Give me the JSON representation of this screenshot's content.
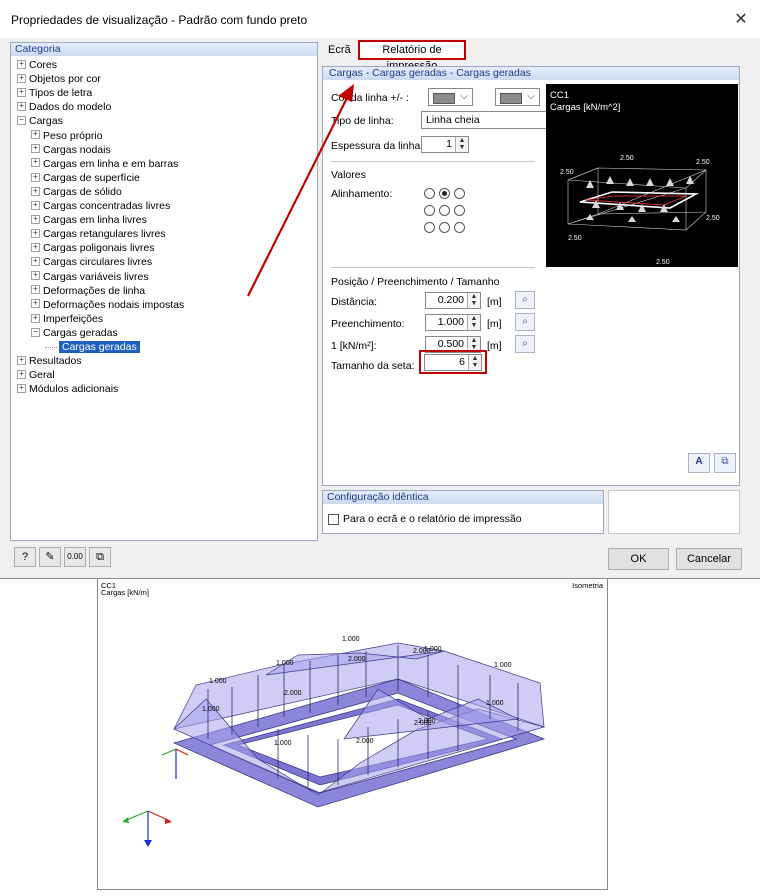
{
  "dialog": {
    "title": "Propriedades de visualização - Padrão com fundo preto",
    "close_glyph": "✕"
  },
  "category": {
    "header": "Categoria",
    "tree": [
      {
        "label": "Cores",
        "indent": 0,
        "expander": "+"
      },
      {
        "label": "Objetos por cor",
        "indent": 0,
        "expander": "+"
      },
      {
        "label": "Tipos de letra",
        "indent": 0,
        "expander": "+"
      },
      {
        "label": "Dados do modelo",
        "indent": 0,
        "expander": "+"
      },
      {
        "label": "Cargas",
        "indent": 0,
        "expander": "−"
      },
      {
        "label": "Peso próprio",
        "indent": 1,
        "expander": "+"
      },
      {
        "label": "Cargas nodais",
        "indent": 1,
        "expander": "+"
      },
      {
        "label": "Cargas em linha e em barras",
        "indent": 1,
        "expander": "+"
      },
      {
        "label": "Cargas de superfície",
        "indent": 1,
        "expander": "+"
      },
      {
        "label": "Cargas de sólido",
        "indent": 1,
        "expander": "+"
      },
      {
        "label": "Cargas concentradas livres",
        "indent": 1,
        "expander": "+"
      },
      {
        "label": "Cargas em linha livres",
        "indent": 1,
        "expander": "+"
      },
      {
        "label": "Cargas retangulares livres",
        "indent": 1,
        "expander": "+"
      },
      {
        "label": "Cargas poligonais livres",
        "indent": 1,
        "expander": "+"
      },
      {
        "label": "Cargas circulares livres",
        "indent": 1,
        "expander": "+"
      },
      {
        "label": "Cargas variáveis livres",
        "indent": 1,
        "expander": "+"
      },
      {
        "label": "Deformações de linha",
        "indent": 1,
        "expander": "+"
      },
      {
        "label": "Deformações nodais impostas",
        "indent": 1,
        "expander": "+"
      },
      {
        "label": "Imperfeições",
        "indent": 1,
        "expander": "+"
      },
      {
        "label": "Cargas geradas",
        "indent": 1,
        "expander": "−"
      },
      {
        "label": "Cargas geradas",
        "indent": 2,
        "expander": "",
        "selected": true
      },
      {
        "label": "Resultados",
        "indent": 0,
        "expander": "+"
      },
      {
        "label": "Geral",
        "indent": 0,
        "expander": "+"
      },
      {
        "label": "Módulos adicionais",
        "indent": 0,
        "expander": "+"
      }
    ]
  },
  "tabs": {
    "screen": "Ecrã",
    "print_report": "Relatório de impressão"
  },
  "section": {
    "header": "Cargas - Cargas geradas - Cargas geradas",
    "line_color_label": "Cor da linha +/- :",
    "line_type_label": "Tipo de linha:",
    "line_type_value": "Linha cheia",
    "line_thickness_label": "Espessura da linha:",
    "line_thickness_value": "1",
    "values_group": "Valores",
    "alignment_label": "Alinhamento:",
    "position_group": "Posição / Preenchimento / Tamanho",
    "distance_label": "Distância:",
    "distance_value": "0.200",
    "distance_unit": "[m]",
    "fill_label": "Preenchimento:",
    "fill_value": "1.000",
    "fill_unit": "[m]",
    "scale_label": "1  [kN/m²]:",
    "scale_value": "0.500",
    "scale_unit": "[m]",
    "arrow_size_label": "Tamanho da seta:",
    "arrow_size_value": "6"
  },
  "preview": {
    "case": "CC1",
    "subtitle": "Cargas [kN/m^2]",
    "labels": [
      "2.50",
      "2.50",
      "2.50",
      "2.50",
      "2.50",
      "2.50"
    ]
  },
  "identical": {
    "header": "Configuração idêntica",
    "checkbox_label": "Para o ecrã e o relatório de impressão"
  },
  "footer": {
    "ok": "OK",
    "cancel": "Cancelar"
  },
  "report": {
    "case": "CC1",
    "subtitle": "Cargas [kN/m]",
    "view": "Isometria",
    "values": [
      "1.000",
      "1.000",
      "2.000",
      "2.000",
      "1.000",
      "2.000",
      "1.000",
      "1.000",
      "1.000",
      "2.000",
      "1.000",
      "2.000",
      "1.000",
      "2.000"
    ]
  },
  "colors": {
    "highlight": "#c00000",
    "selection": "#1e5fbf",
    "load_fill": "#7c6fd6"
  }
}
